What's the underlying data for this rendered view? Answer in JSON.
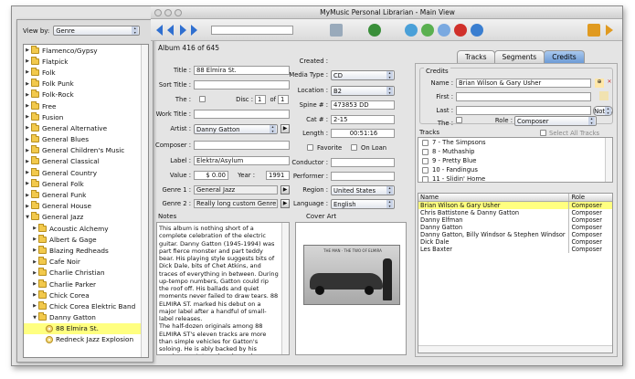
{
  "window": {
    "title": "MyMusic Personal Librarian - Main View"
  },
  "drawer": {
    "view_by_label": "View by:",
    "view_by_value": "Genre",
    "tree": [
      {
        "label": "Flamenco/Gypsy",
        "indent": 0,
        "open": false
      },
      {
        "label": "Flatpick",
        "indent": 0,
        "open": false
      },
      {
        "label": "Folk",
        "indent": 0,
        "open": false
      },
      {
        "label": "Folk Punk",
        "indent": 0,
        "open": false
      },
      {
        "label": "Folk-Rock",
        "indent": 0,
        "open": false
      },
      {
        "label": "Free",
        "indent": 0,
        "open": false
      },
      {
        "label": "Fusion",
        "indent": 0,
        "open": false
      },
      {
        "label": "General Alternative",
        "indent": 0,
        "open": false
      },
      {
        "label": "General Blues",
        "indent": 0,
        "open": false
      },
      {
        "label": "General Children's Music",
        "indent": 0,
        "open": false
      },
      {
        "label": "General Classical",
        "indent": 0,
        "open": false
      },
      {
        "label": "General Country",
        "indent": 0,
        "open": false
      },
      {
        "label": "General Folk",
        "indent": 0,
        "open": false
      },
      {
        "label": "General Funk",
        "indent": 0,
        "open": false
      },
      {
        "label": "General House",
        "indent": 0,
        "open": false
      },
      {
        "label": "General Jazz",
        "indent": 0,
        "open": true
      },
      {
        "label": "Acoustic Alchemy",
        "indent": 1,
        "open": false
      },
      {
        "label": "Albert & Gage",
        "indent": 1,
        "open": false
      },
      {
        "label": "Blazing Redheads",
        "indent": 1,
        "open": false
      },
      {
        "label": "Cafe Noir",
        "indent": 1,
        "open": false
      },
      {
        "label": "Charlie Christian",
        "indent": 1,
        "open": false
      },
      {
        "label": "Charlie Parker",
        "indent": 1,
        "open": false
      },
      {
        "label": "Chick Corea",
        "indent": 1,
        "open": false
      },
      {
        "label": "Chick Corea Elektric Band",
        "indent": 1,
        "open": false
      },
      {
        "label": "Danny Gatton",
        "indent": 1,
        "open": true
      },
      {
        "label": "88 Elmira St.",
        "indent": 2,
        "album": true,
        "selected": true
      },
      {
        "label": "Redneck Jazz Explosion",
        "indent": 2,
        "album": true
      }
    ]
  },
  "album": {
    "counter": "Album 416 of 645",
    "title_label": "Title :",
    "title": "88 Elmira St.",
    "sort_title_label": "Sort Title :",
    "sort_title": "",
    "the_label": "The :",
    "disc_label": "Disc :",
    "disc": "1",
    "of_label": "of",
    "disc_total": "1",
    "work_title_label": "Work Title :",
    "work_title": "",
    "artist_label": "Artist :",
    "artist": "Danny Gatton",
    "composer_label": "Composer :",
    "composer": "",
    "label_label": "Label :",
    "label": "Elektra/Asylum",
    "value_label": "Value :",
    "value": "$ 0.00",
    "year_label": "Year :",
    "year": "1991",
    "genre1_label": "Genre 1 :",
    "genre1": "General Jazz",
    "genre2_label": "Genre 2 :",
    "genre2": "Really long custom Genre",
    "created_label": "Created :",
    "created": "",
    "media_label": "Media Type :",
    "media": "CD",
    "location_label": "Location :",
    "location": "B2",
    "spine_label": "Spine # :",
    "spine": "473853 DD",
    "cat_label": "Cat # :",
    "cat": "2-15",
    "length_label": "Length :",
    "length": "00:51:16",
    "favorite_label": "Favorite",
    "onloan_label": "On Loan",
    "conductor_label": "Conductor :",
    "conductor": "",
    "performer_label": "Performer :",
    "performer": "",
    "region_label": "Region :",
    "region": "United States",
    "language_label": "Language :",
    "language": "English",
    "notes_label": "Notes",
    "cover_label": "Cover Art",
    "notes": "This album is nothing short of a complete celebration of the electric guitar. Danny Gatton (1945-1994) was part fierce monster and part teddy bear. His playing style suggests bits of Dick Dale, bits of Chet Atkins, and traces of everything in between. During up-tempo numbers, Gatton could rip the roof off. His ballads and quiet moments never failed to draw tears. 88 ELMIRA ST. marked his debut on a major label after a handful of small-label releases.\nThe half-dozen originals among 88 ELMIRA ST's eleven tracks are more than simple vehicles for Gatton's soloing. He is ably backed by his regular quartet, and each number shows sharp character and a sense",
    "cover_text": "THE MAN · THE TWO OF ELMIRA"
  },
  "tabs": [
    {
      "label": "Tracks"
    },
    {
      "label": "Segments"
    },
    {
      "label": "Credits",
      "active": true
    }
  ],
  "credits": {
    "title": "Credits",
    "name_label": "Name :",
    "name": "Brian Wilson & Gary Usher",
    "first_label": "First :",
    "first": "",
    "last_label": "Last :",
    "last": "",
    "notes_btn": "Notes",
    "the_label": "The :",
    "role_label": "Role :",
    "role": "Composer",
    "tracks_label": "Tracks",
    "select_all_label": "Select All Tracks",
    "tracks": [
      "7 - The Simpsons",
      "8 - Muthaship",
      "9 - Pretty Blue",
      "10 - Fandingus",
      "11 - Slidin' Home"
    ],
    "table_headers": [
      "Name",
      "Role"
    ],
    "rows": [
      {
        "name": "Brian Wilson & Gary Usher",
        "role": "Composer",
        "selected": true
      },
      {
        "name": "Chris Battistone & Danny Gatton",
        "role": "Composer"
      },
      {
        "name": "Danny Elfman",
        "role": "Composer"
      },
      {
        "name": "Danny Gatton",
        "role": "Composer"
      },
      {
        "name": "Danny Gatton, Billy Windsor & Stephen Windsor",
        "role": "Composer"
      },
      {
        "name": "Dick Dale",
        "role": "Composer"
      },
      {
        "name": "Les Baxter",
        "role": "Composer"
      }
    ]
  },
  "colors": {
    "selection": "#ffff80",
    "accent": "#6d9bd6",
    "folder": "#f2c94c"
  }
}
